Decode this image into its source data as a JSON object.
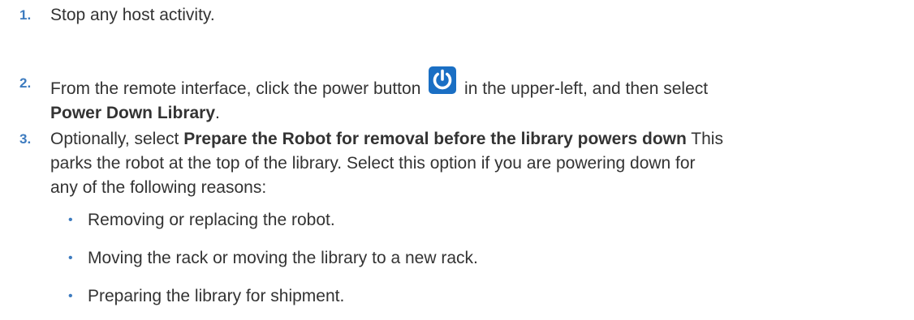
{
  "steps": [
    {
      "number": "1.",
      "text": "Stop any host activity."
    },
    {
      "number": "2.",
      "text_before_icon": "From the remote interface, click the power button",
      "icon": "power-icon",
      "text_after_icon": " in the upper-left, and then select",
      "bold": "Power Down Library",
      "trailing": "."
    },
    {
      "number": "3.",
      "text_before_bold": "Optionally, select ",
      "bold": "Prepare the Robot for removal before the library powers down",
      "line1_tail": " This",
      "line2": "parks the robot at the top of the library. Select this option if you are powering down for",
      "line3": "any of the following reasons:",
      "bullets": [
        "Removing or replacing the robot.",
        "Moving the rack or moving the library to a new rack.",
        "Preparing the library for shipment."
      ]
    }
  ],
  "colors": {
    "text": "#333333",
    "accent": "#3d7bbf",
    "icon_bg": "#1a6fc4",
    "icon_fg": "#ffffff"
  }
}
